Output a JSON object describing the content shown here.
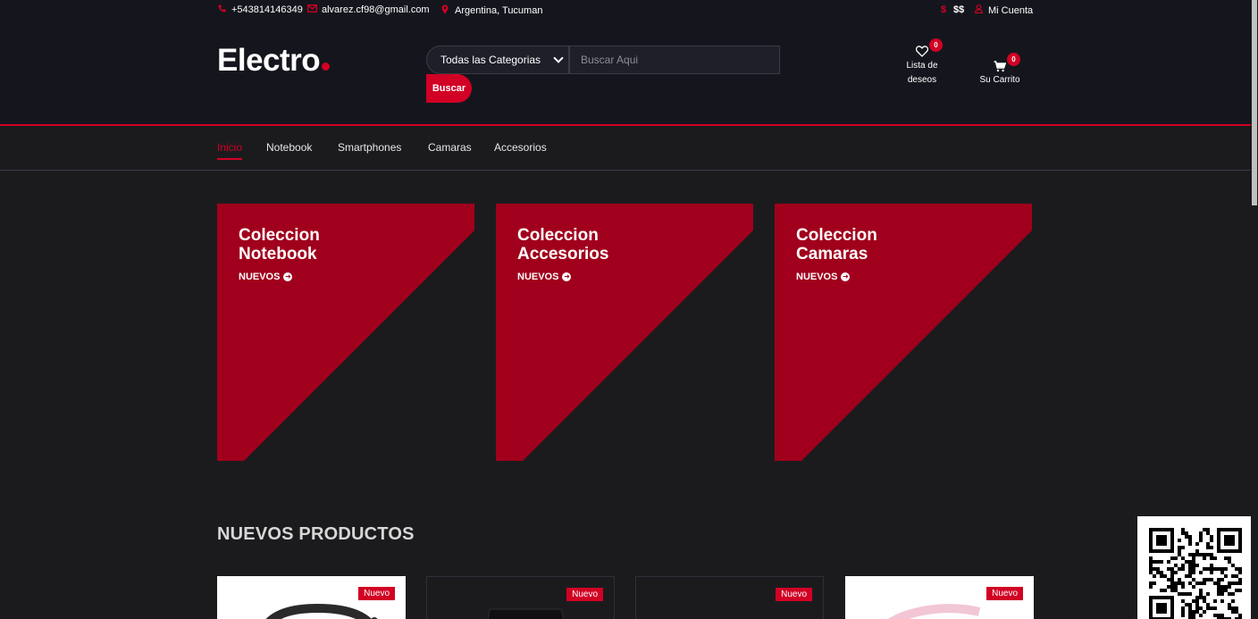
{
  "topbar": {
    "phone": "+543814146349",
    "email": "alvarez.cf98@gmail.com",
    "location": "Argentina, Tucuman",
    "currency": "$$",
    "account": "Mi Cuenta"
  },
  "header": {
    "logo": "Electro",
    "category_select": "Todas las Categorias",
    "search_placeholder": "Buscar Aqui",
    "search_button": "Buscar",
    "wishlist_label_1": "Lista de",
    "wishlist_label_2": "deseos",
    "wishlist_count": "0",
    "cart_label": "Su Carrito",
    "cart_count": "0"
  },
  "nav": {
    "items": [
      "Inicio",
      "Notebook",
      "Smartphones",
      "Camaras",
      "Accesorios"
    ]
  },
  "collections": [
    {
      "line1": "Coleccion",
      "line2": "Notebook",
      "cta": "NUEVOS"
    },
    {
      "line1": "Coleccion",
      "line2": "Accesorios",
      "cta": "NUEVOS"
    },
    {
      "line1": "Coleccion",
      "line2": "Camaras",
      "cta": "NUEVOS"
    }
  ],
  "section_title": "NUEVOS PRODUCTOS",
  "products": [
    {
      "badge": "Nuevo"
    },
    {
      "badge": "Nuevo"
    },
    {
      "badge": "Nuevo"
    },
    {
      "badge": "Nuevo"
    }
  ],
  "colors": {
    "accent": "#d10024",
    "card": "#a0001c",
    "background": "#1b1b1e",
    "header": "#15161d"
  }
}
